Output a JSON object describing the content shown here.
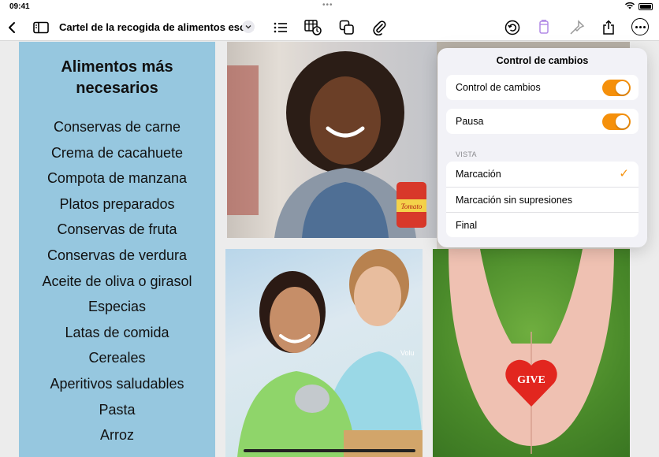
{
  "status_bar": {
    "time": "09:41",
    "dots": "•••"
  },
  "toolbar": {
    "document_title": "Cartel de la recogida de alimentos esc...",
    "icons": [
      "back-chevron-icon",
      "sidebar-icon",
      "title-menu-chevron-icon",
      "list-icon",
      "table-chart-icon",
      "shapes-icon",
      "paperclip-icon",
      "undo-icon",
      "paintbrush-format-icon",
      "pin-icon",
      "share-icon",
      "more-icon"
    ]
  },
  "list_panel": {
    "heading_line1": "Alimentos más",
    "heading_line2": "necesarios",
    "items": [
      "Conservas de carne",
      "Crema de cacahuete",
      "Compota de manzana",
      "Platos preparados",
      "Conservas de fruta",
      "Conservas de verdura",
      "Aceite de oliva o girasol",
      "Especias",
      "Latas de comida",
      "Cereales",
      "Aperitivos saludables",
      "Pasta",
      "Arroz"
    ]
  },
  "photos": {
    "can_label": "Tomato",
    "heart_text": "GIVE",
    "shirt_text": "Volu"
  },
  "popover": {
    "title": "Control de cambios",
    "toggles": [
      {
        "label": "Control de cambios",
        "on": true
      },
      {
        "label": "Pausa",
        "on": true
      }
    ],
    "section_label": "VISTA",
    "view_options": [
      {
        "label": "Marcación",
        "selected": true
      },
      {
        "label": "Marcación sin supresiones",
        "selected": false
      },
      {
        "label": "Final",
        "selected": false
      }
    ],
    "check_mark": "✓"
  },
  "colors": {
    "accent": "#f5900b",
    "list_panel_bg": "#96c7df",
    "purple_icon": "#b28ae6"
  }
}
